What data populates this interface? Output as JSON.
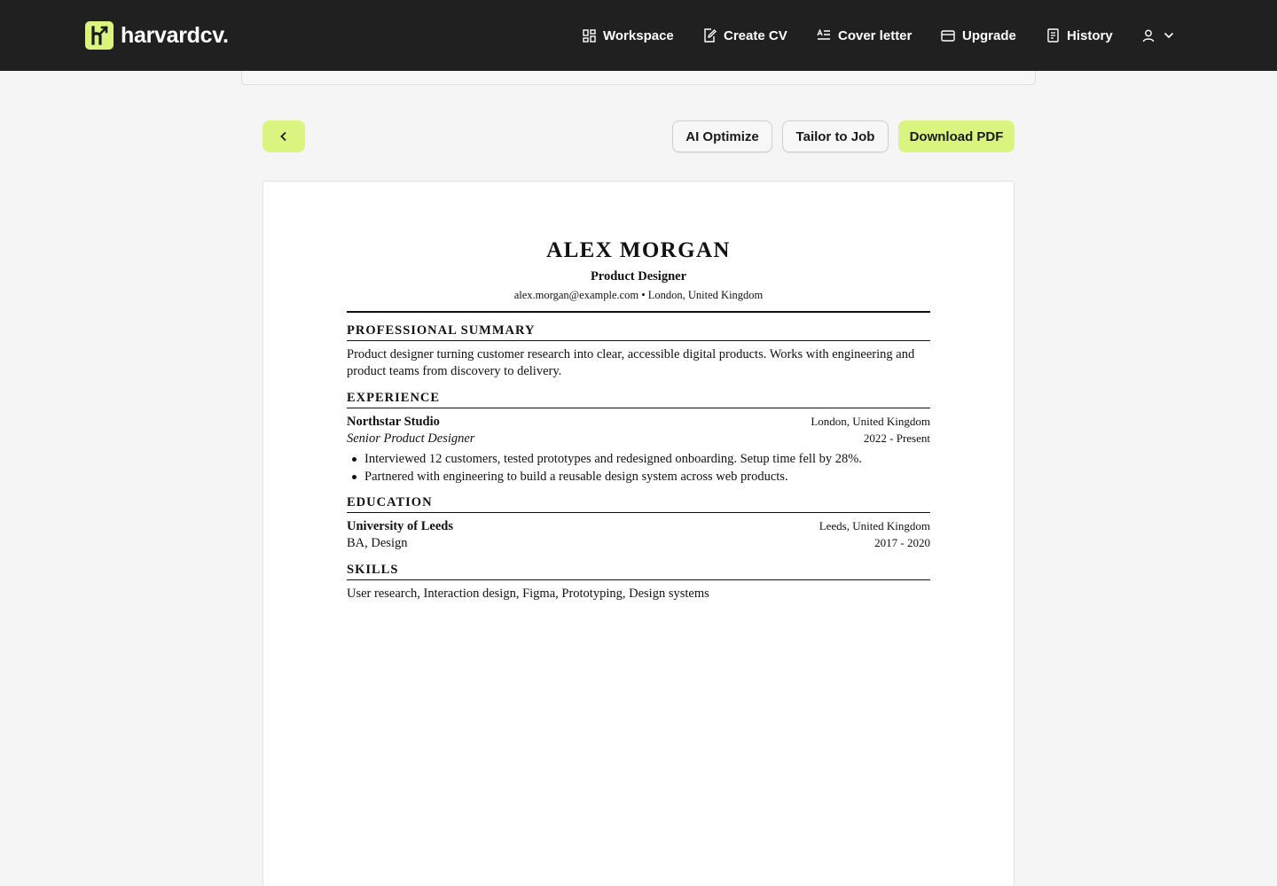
{
  "brand": {
    "name": "harvardcv."
  },
  "nav": {
    "workspace": "Workspace",
    "create_cv": "Create CV",
    "cover_letter": "Cover letter",
    "upgrade": "Upgrade",
    "history": "History"
  },
  "toolbar": {
    "ai_optimize": "AI Optimize",
    "tailor_to_job": "Tailor to Job",
    "download_pdf": "Download PDF"
  },
  "colors": {
    "accent": "#d9f57f",
    "header_bg": "#202020",
    "page_bg": "#f5f5f5"
  },
  "icons": [
    "back-chevron-icon",
    "dashboard-grid-icon",
    "edit-document-icon",
    "text-lines-icon",
    "credit-card-icon",
    "document-list-icon",
    "user-icon",
    "chevron-down-icon"
  ],
  "cv": {
    "name": "ALEX MORGAN",
    "role": "Product Designer",
    "contact": "alex.morgan@example.com • London, United Kingdom",
    "summary_heading": "PROFESSIONAL SUMMARY",
    "summary_line1": "Product designer turning customer research into clear, accessible digital products. Works with engineering and",
    "summary_line2": "product teams from discovery to delivery.",
    "experience_heading": "EXPERIENCE",
    "experience": {
      "company": "Northstar Studio",
      "location": "London, United Kingdom",
      "title": "Senior Product Designer",
      "dates": "2022 - Present",
      "bullets": [
        "Interviewed 12 customers, tested prototypes and redesigned onboarding. Setup time fell by 28%.",
        "Partnered with engineering to build a reusable design system across web products."
      ]
    },
    "education_heading": "EDUCATION",
    "education": {
      "school": "University of Leeds",
      "location": "Leeds, United Kingdom",
      "degree": "BA, Design",
      "dates": "2017 - 2020"
    },
    "skills_heading": "SKILLS",
    "skills": "User research, Interaction design, Figma, Prototyping, Design systems"
  }
}
